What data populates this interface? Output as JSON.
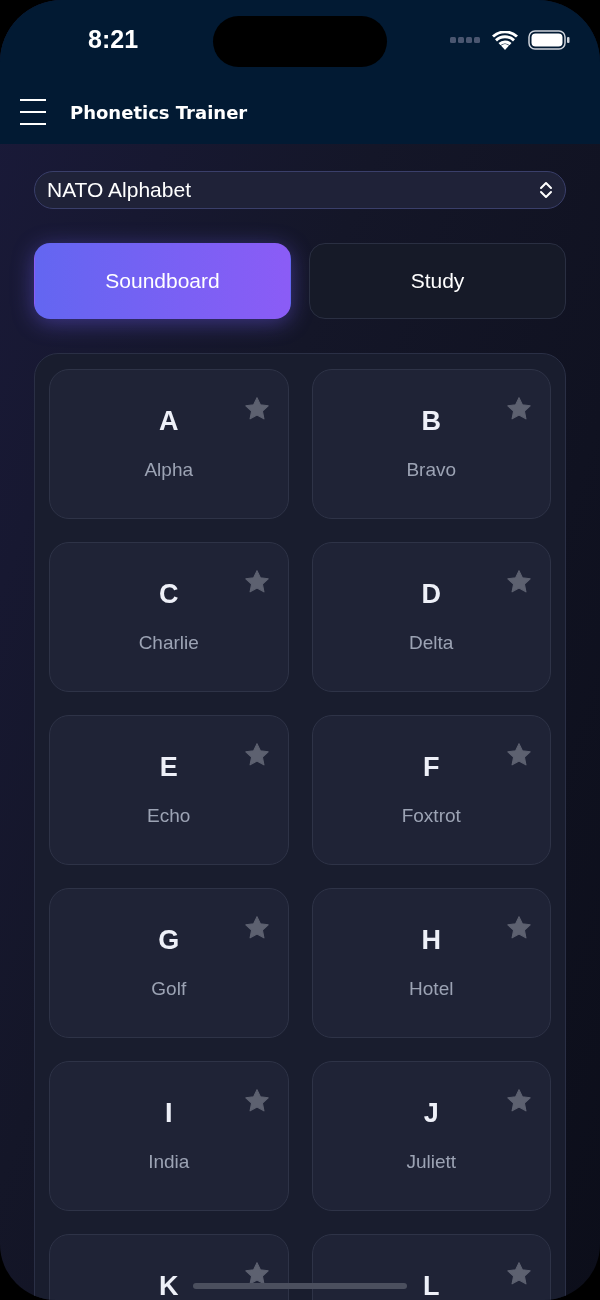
{
  "status_bar": {
    "time": "8:21"
  },
  "header": {
    "title": "Phonetics Trainer"
  },
  "alphabet_picker": {
    "value": "NATO Alphabet"
  },
  "tabs": [
    {
      "label": "Soundboard",
      "selected": true
    },
    {
      "label": "Study",
      "selected": false
    }
  ],
  "cards": [
    {
      "letter": "A",
      "word": "Alpha",
      "favorite": false
    },
    {
      "letter": "B",
      "word": "Bravo",
      "favorite": false
    },
    {
      "letter": "C",
      "word": "Charlie",
      "favorite": false
    },
    {
      "letter": "D",
      "word": "Delta",
      "favorite": false
    },
    {
      "letter": "E",
      "word": "Echo",
      "favorite": false
    },
    {
      "letter": "F",
      "word": "Foxtrot",
      "favorite": false
    },
    {
      "letter": "G",
      "word": "Golf",
      "favorite": false
    },
    {
      "letter": "H",
      "word": "Hotel",
      "favorite": false
    },
    {
      "letter": "I",
      "word": "India",
      "favorite": false
    },
    {
      "letter": "J",
      "word": "Juliett",
      "favorite": false
    },
    {
      "letter": "K",
      "favorite": false
    },
    {
      "letter": "L",
      "favorite": false
    }
  ]
}
